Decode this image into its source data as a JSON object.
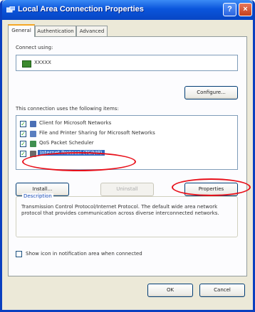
{
  "window": {
    "title": "Local Area Connection Properties",
    "help": "?",
    "close": "×"
  },
  "tabs": [
    "General",
    "Authentication",
    "Advanced"
  ],
  "connect_using": {
    "label": "Connect using:",
    "adapter": "XXXXX"
  },
  "configure_label": "Configure...",
  "components": {
    "label": "This connection uses the following items:",
    "items": [
      {
        "label": "Client for Microsoft Networks",
        "checked": true,
        "icon_color": "#4a6fb5"
      },
      {
        "label": "File and Printer Sharing for Microsoft Networks",
        "checked": true,
        "icon_color": "#5a7fc0"
      },
      {
        "label": "QoS Packet Scheduler",
        "checked": true,
        "icon_color": "#3f8f4f"
      },
      {
        "label": "Internet Protocol (TCP/IP)",
        "checked": true,
        "icon_color": "#6a6a6a",
        "selected": true
      }
    ]
  },
  "buttons": {
    "install": "Install...",
    "uninstall": "Uninstall",
    "properties": "Properties",
    "ok": "OK",
    "cancel": "Cancel"
  },
  "description": {
    "title": "Description",
    "text": "Transmission Control Protocol/Internet Protocol. The default wide area network protocol that provides communication across diverse interconnected networks."
  },
  "notify": {
    "label": "Show icon in notification area when connected",
    "checked": false
  },
  "colors": {
    "titlebar": "#0a55dc",
    "selection": "#316ac5",
    "annotation": "#e8101a"
  }
}
